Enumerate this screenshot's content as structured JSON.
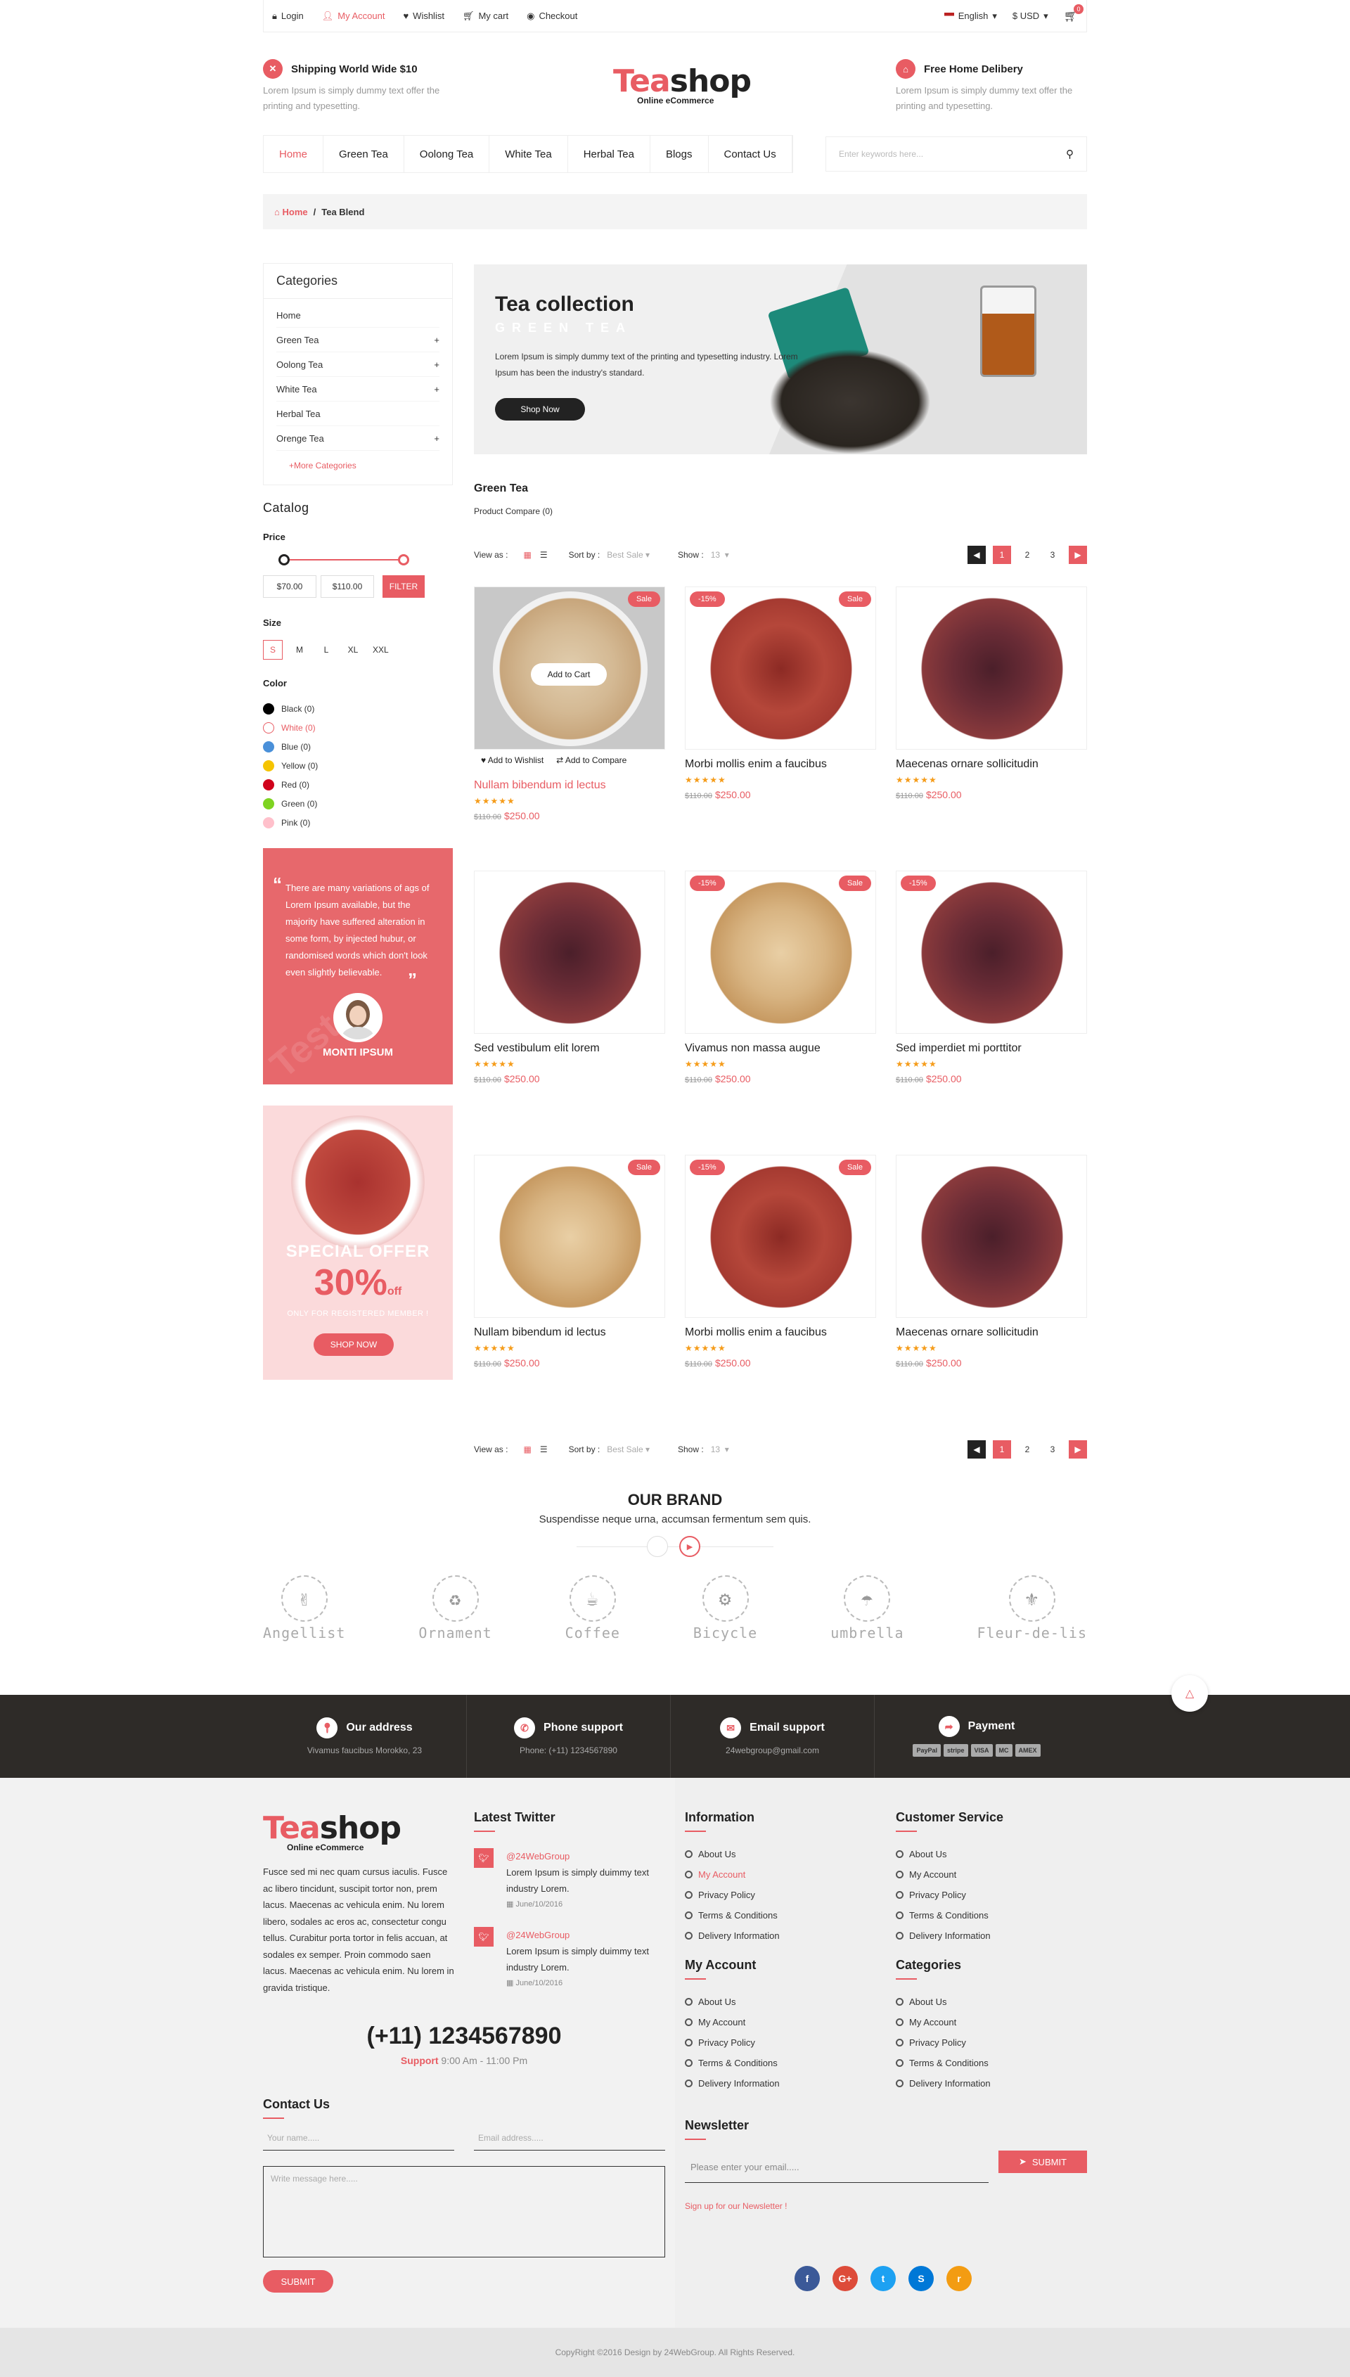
{
  "topbar": {
    "login": "Login",
    "account": "My Account",
    "wishlist": "Wishlist",
    "cart": "My cart",
    "checkout": "Checkout",
    "language": "English",
    "currency": "$ USD",
    "cart_count": "0"
  },
  "header": {
    "ship_title": "Shipping World Wide $10",
    "ship_desc": "Lorem Ipsum is simply dummy text offer the printing and typesetting.",
    "logo_accent": "Tea",
    "logo_rest": "shop",
    "logo_sub": "Online eCommerce",
    "deliv_title": "Free Home Delibery",
    "deliv_desc": "Lorem Ipsum is simply dummy text offer the printing and typesetting."
  },
  "nav": [
    "Home",
    "Green Tea",
    "Oolong Tea",
    "White Tea",
    "Herbal Tea",
    "Blogs",
    "Contact Us"
  ],
  "search": {
    "placeholder": "Enter keywords here..."
  },
  "breadcrumb": {
    "home": "Home",
    "sep": "/",
    "current": "Tea Blend"
  },
  "categories": {
    "title": "Categories",
    "items": [
      {
        "label": "Home",
        "plus": ""
      },
      {
        "label": "Green Tea",
        "plus": "+"
      },
      {
        "label": "Oolong Tea",
        "plus": "+"
      },
      {
        "label": "White Tea",
        "plus": "+"
      },
      {
        "label": "Herbal Tea",
        "plus": ""
      },
      {
        "label": "Orenge Tea",
        "plus": "+"
      }
    ],
    "more": "+More Categories"
  },
  "catalog": {
    "title": "Catalog",
    "price_label": "Price",
    "min": "$70.00",
    "max": "$110.00",
    "filter": "FILTER",
    "size_label": "Size",
    "sizes": [
      "S",
      "M",
      "L",
      "XL",
      "XXL"
    ],
    "color_label": "Color",
    "colors": [
      {
        "name": "Black (0)",
        "hex": "#000000"
      },
      {
        "name": "White (0)",
        "hex": "#ffffff"
      },
      {
        "name": "Blue (0)",
        "hex": "#4a90d9"
      },
      {
        "name": "Yellow (0)",
        "hex": "#f5c400"
      },
      {
        "name": "Red (0)",
        "hex": "#d0021b"
      },
      {
        "name": "Green (0)",
        "hex": "#7ed321"
      },
      {
        "name": "Pink (0)",
        "hex": "#ffc0cb"
      }
    ]
  },
  "testimonial": {
    "text": "There are many variations of ags of Lorem Ipsum available, but the majority have suffered alteration in some form, by injected hubur, or randomised words which don't look even slightly believable.",
    "name": "MONTI IPSUM",
    "watermark": "Test"
  },
  "offer": {
    "title": "SPECIAL OFFER",
    "percent": "30%",
    "off": "off",
    "note": "ONLY FOR REGISTERED MEMBER !",
    "button": "SHOP NOW"
  },
  "banner": {
    "title": "Tea collection",
    "subtitle": "GREEN TEA",
    "desc": "Lorem Ipsum is simply dummy text of the printing and typesetting industry. Lorem Ipsum has been the industry's standard.",
    "button": "Shop Now"
  },
  "listing": {
    "title": "Green Tea",
    "compare": "Product Compare (0)",
    "view_as": "View as :",
    "sort_by": "Sort by :",
    "sort_value": "Best Sale",
    "show": "Show :",
    "show_value": "13",
    "pages": [
      "1",
      "2",
      "3"
    ]
  },
  "products": [
    {
      "name": "Nullam bibendum id lectus",
      "old": "$110.00",
      "price": "$250.00",
      "badges": [
        "Sale"
      ],
      "type": "light",
      "hover": true
    },
    {
      "name": "Morbi mollis enim a faucibus",
      "old": "$110.00",
      "price": "$250.00",
      "badges": [
        "-15%",
        "Sale"
      ],
      "type": "red"
    },
    {
      "name": "Maecenas ornare sollicitudin",
      "old": "$110.00",
      "price": "$250.00",
      "badges": [],
      "type": "dark"
    },
    {
      "name": "Sed vestibulum elit lorem",
      "old": "$110.00",
      "price": "$250.00",
      "badges": [],
      "type": "dark"
    },
    {
      "name": "Vivamus non massa augue",
      "old": "$110.00",
      "price": "$250.00",
      "badges": [
        "-15%",
        "Sale"
      ],
      "type": "light"
    },
    {
      "name": "Sed imperdiet mi porttitor",
      "old": "$110.00",
      "price": "$250.00",
      "badges": [
        "-15%"
      ],
      "type": "dark"
    },
    {
      "name": "Nullam bibendum id lectus",
      "old": "$110.00",
      "price": "$250.00",
      "badges": [
        "Sale"
      ],
      "type": "light"
    },
    {
      "name": "Morbi mollis enim a faucibus",
      "old": "$110.00",
      "price": "$250.00",
      "badges": [
        "-15%",
        "Sale"
      ],
      "type": "red"
    },
    {
      "name": "Maecenas ornare sollicitudin",
      "old": "$110.00",
      "price": "$250.00",
      "badges": [],
      "type": "dark"
    }
  ],
  "hover_actions": {
    "add_to_cart": "Add to Cart",
    "wishlist": "Add to Wishlist",
    "compare": "Add to Compare"
  },
  "brand": {
    "title": "OUR BRAND",
    "subtitle": "Suspendisse neque urna, accumsan fermentum sem quis.",
    "items": [
      {
        "name": "Angellist",
        "icon": "✌"
      },
      {
        "name": "Ornament",
        "icon": "♻"
      },
      {
        "name": "Coffee",
        "icon": "☕"
      },
      {
        "name": "Bicycle",
        "icon": "⚙"
      },
      {
        "name": "umbrella",
        "icon": "☂"
      },
      {
        "name": "Fleur-de-lis",
        "icon": "⚜"
      }
    ]
  },
  "services": {
    "address_t": "Our address",
    "address_v": "Vivamus faucibus Morokko, 23",
    "phone_t": "Phone support",
    "phone_v": "Phone: (+11) 1234567890",
    "email_t": "Email support",
    "email_v": "24webgroup@gmail.com",
    "payment_t": "Payment",
    "payments": [
      "PayPal",
      "stripe",
      "VISA",
      "MC",
      "AMEX"
    ]
  },
  "footer": {
    "about": "Fusce sed mi nec quam cursus iaculis. Fusce ac libero tincidunt, suscipit tortor non, prem lacus. Maecenas ac vehicula enim. Nu lorem libero, sodales ac eros ac, consectetur congu tellus. Curabitur porta tortor in felis accuan, at sodales ex semper. Proin commodo saen lacus. Maecenas ac vehicula enim. Nu lorem in gravida tristique.",
    "phone": "(+11) 1234567890",
    "support_label": "Support",
    "support_hours": "9:00 Am - 11:00 Pm",
    "twitter_title": "Latest Twitter",
    "tweets": [
      {
        "handle": "@24WebGroup",
        "text": "Lorem Ipsum is simply duimmy text industry Lorem.",
        "date": "June/10/2016"
      },
      {
        "handle": "@24WebGroup",
        "text": "Lorem Ipsum is simply duimmy text industry Lorem.",
        "date": "June/10/2016"
      }
    ],
    "info_title": "Information",
    "info": [
      "About Us",
      "My Account",
      "Privacy Policy",
      "Terms & Conditions",
      "Delivery Information"
    ],
    "cs_title": "Customer  Service",
    "cs": [
      "About Us",
      "My Account",
      "Privacy Policy",
      "Terms & Conditions",
      "Delivery Information"
    ],
    "acc_title": "My Account",
    "acc": [
      "About Us",
      "My Account",
      "Privacy Policy",
      "Terms & Conditions",
      "Delivery Information"
    ],
    "cat_title": "Categories",
    "cats": [
      "About Us",
      "My Account",
      "Privacy Policy",
      "Terms & Conditions",
      "Delivery Information"
    ],
    "contact_title": "Contact Us",
    "name_ph": "Your name.....",
    "email_ph": "Email address.....",
    "msg_ph": "Write message here.....",
    "submit": "SUBMIT",
    "news_title": "Newsletter",
    "news_ph": "Please enter your email.....",
    "news_btn": "SUBMIT",
    "news_link": "Sign up for our Newsletter !",
    "social": [
      {
        "l": "f",
        "c": "#3b5998"
      },
      {
        "l": "G+",
        "c": "#dd4b39"
      },
      {
        "l": "t",
        "c": "#1da1f2"
      },
      {
        "l": "S",
        "c": "#0078d7"
      },
      {
        "l": "r",
        "c": "#f39c12"
      }
    ],
    "copyright": "CopyRight ©2016 Design by 24WebGroup. All Rights Reserved."
  }
}
